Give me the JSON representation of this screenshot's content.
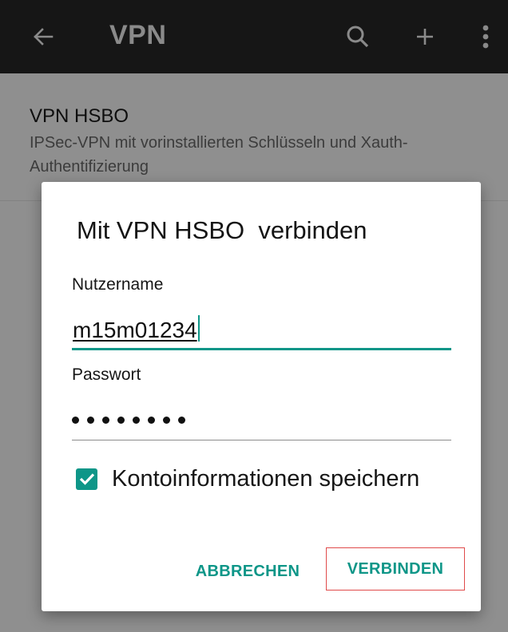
{
  "appbar": {
    "back_icon": "arrow-left-icon",
    "title": "VPN",
    "actions": [
      {
        "icon": "search-icon"
      },
      {
        "icon": "plus-icon"
      },
      {
        "icon": "more-vertical-icon"
      }
    ]
  },
  "vpn_list": {
    "items": [
      {
        "name": "VPN HSBO",
        "description": "IPSec-VPN mit vorinstallierten Schlüsseln und Xauth-Authentifizierung"
      }
    ]
  },
  "dialog": {
    "title": "Mit VPN HSBO  verbinden",
    "username_label": "Nutzername",
    "username_value": "m15m01234",
    "password_label": "Passwort",
    "password_length": 8,
    "save_label": "Kontoinformationen speichern",
    "save_checked": true,
    "cancel_label": "ABBRECHEN",
    "connect_label": "VERBINDEN"
  },
  "colors": {
    "accent": "#0e9688",
    "appbar": "#161616",
    "scrim": "#8f8f8f",
    "highlight_border": "#e04b4b"
  }
}
